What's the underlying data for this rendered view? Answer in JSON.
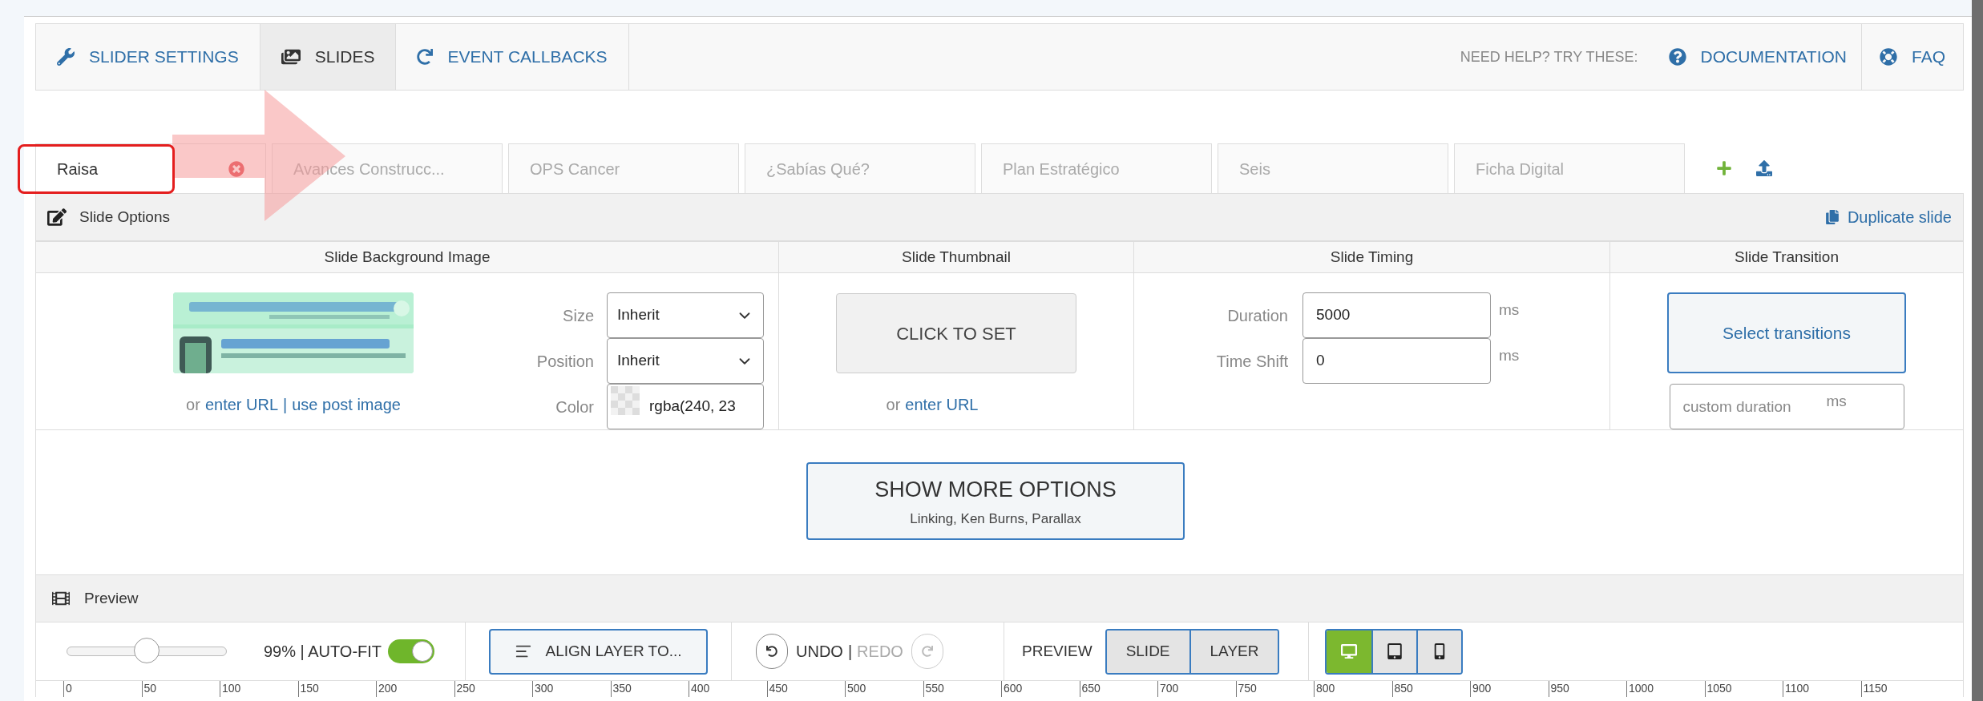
{
  "top_nav": {
    "tabs": [
      {
        "label": "SLIDER SETTINGS",
        "kind": "wrench",
        "selected": false
      },
      {
        "label": "SLIDES",
        "kind": "slides",
        "selected": true
      },
      {
        "label": "EVENT CALLBACKS",
        "kind": "redo",
        "selected": false
      }
    ],
    "help_prompt": "NEED HELP? TRY THESE:",
    "links": [
      {
        "label": "DOCUMENTATION",
        "kind": "help"
      },
      {
        "label": "FAQ",
        "kind": "lifebuoy"
      }
    ]
  },
  "slide_tabs": [
    {
      "label": "Raisa",
      "selected": true
    },
    {
      "label": "Avances Construcc...",
      "selected": false
    },
    {
      "label": "OPS Cancer",
      "selected": false
    },
    {
      "label": "¿Sabías Qué?",
      "selected": false
    },
    {
      "label": "Plan Estratégico",
      "selected": false
    },
    {
      "label": "Seis",
      "selected": false
    },
    {
      "label": "Ficha Digital",
      "selected": false
    }
  ],
  "slide_options": {
    "title": "Slide Options",
    "duplicate": "Duplicate slide"
  },
  "background": {
    "heading": "Slide Background Image",
    "image": {
      "kind": "picture"
    },
    "prefix": "or",
    "links": [
      "enter URL",
      "use post image"
    ],
    "separator": "|",
    "fields": [
      {
        "label": "Size",
        "value": "Inherit",
        "kind": "select"
      },
      {
        "label": "Position",
        "value": "Inherit",
        "kind": "select"
      },
      {
        "label": "Color",
        "value": "rgba(240, 23",
        "kind": "color"
      }
    ]
  },
  "thumbnail": {
    "heading": "Slide Thumbnail",
    "button": "CLICK TO SET",
    "prefix": "or",
    "link": "enter URL"
  },
  "timing": {
    "heading": "Slide Timing",
    "fields": [
      {
        "label": "Duration",
        "value": "5000",
        "unit": "ms"
      },
      {
        "label": "Time Shift",
        "value": "0",
        "unit": "ms"
      }
    ]
  },
  "transition": {
    "heading": "Slide Transition",
    "button": "Select transitions",
    "custom": {
      "placeholder": "custom duration",
      "unit": "ms"
    }
  },
  "more": {
    "title": "SHOW MORE OPTIONS",
    "subtitle": "Linking, Ken Burns, Parallax"
  },
  "preview": {
    "title": "Preview",
    "zoom": {
      "level": 0.5,
      "reading": "99% | AUTO-FIT",
      "auto_fit": true
    },
    "align": "ALIGN LAYER TO...",
    "undo": {
      "label": "UNDO",
      "separator": "|",
      "redo": "REDO",
      "redo_disabled": true
    },
    "preview_label": "PREVIEW",
    "modes": [
      {
        "label": "SLIDE"
      },
      {
        "label": "LAYER"
      }
    ],
    "devices": [
      {
        "kind": "desktop",
        "selected": true
      },
      {
        "kind": "tablet",
        "selected": false
      },
      {
        "kind": "phone",
        "selected": false
      }
    ]
  },
  "ruler": [
    "0",
    "50",
    "100",
    "150",
    "200",
    "250",
    "300",
    "350",
    "400",
    "450",
    "500",
    "550",
    "600",
    "650",
    "700",
    "750",
    "800",
    "850",
    "900",
    "950",
    "1000",
    "1050",
    "1100",
    "1150"
  ]
}
